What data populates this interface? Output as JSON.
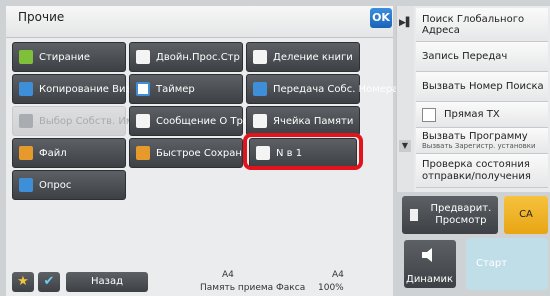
{
  "title": "Прочие",
  "ok": "OK",
  "tiles": [
    {
      "label": "Стирание",
      "icon": "erase-icon"
    },
    {
      "label": "Двойн.Прос.Стр",
      "icon": "duplex-scan-icon"
    },
    {
      "label": "Деление книги",
      "icon": "book-divide-icon"
    },
    {
      "label": "Копирование Визиток",
      "icon": "card-copy-icon"
    },
    {
      "label": "Таймер",
      "icon": "timer-icon"
    },
    {
      "label": "Передача Собс. Номера Факса",
      "icon": "own-fax-icon"
    },
    {
      "label": "Выбор Собств. Имени",
      "icon": "own-name-icon"
    },
    {
      "label": "Сообщение О Транзакции",
      "icon": "transaction-msg-icon"
    },
    {
      "label": "Ячейка Памяти",
      "icon": "memory-box-icon"
    },
    {
      "label": "Файл",
      "icon": "file-icon"
    },
    {
      "label": "Быстрое Сохран",
      "icon": "quick-save-icon"
    },
    {
      "label": "N в 1",
      "icon": "n-in-1-icon"
    },
    {
      "label": "Опрос",
      "icon": "poll-icon"
    }
  ],
  "right": {
    "global_search": "Поиск Глобального Адреса",
    "record_transfer": "Запись Передач",
    "call_search": "Вызвать Номер Поиска",
    "direct_tx": "Прямая TX",
    "call_program": "Вызвать Программу",
    "call_program_sub": "Вызвать Зарегистр. установки",
    "check_status": "Проверка состояния отправки/получения"
  },
  "preview": "Предварит. Просмотр",
  "ca": "CA",
  "speaker": "Динамик",
  "start": "Старт",
  "back": "Назад",
  "status": {
    "a4_left": "A4",
    "a4_right": "A4",
    "memory": "Память приема Факса",
    "percent": "100%"
  }
}
